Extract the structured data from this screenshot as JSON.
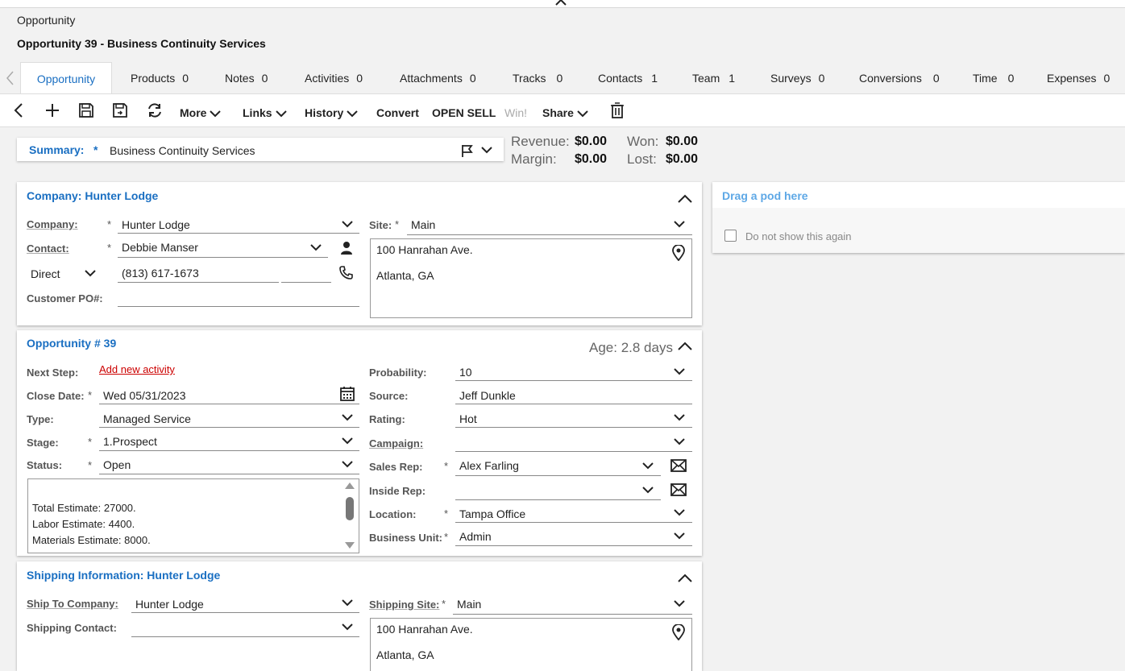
{
  "header": {
    "breadcrumb": "Opportunity",
    "title": "Opportunity 39 - Business Continuity Services"
  },
  "tabs": [
    {
      "label": "Opportunity",
      "count": ""
    },
    {
      "label": "Products",
      "count": "0"
    },
    {
      "label": "Notes",
      "count": "0"
    },
    {
      "label": "Activities",
      "count": "0"
    },
    {
      "label": "Attachments",
      "count": "0"
    },
    {
      "label": "Tracks",
      "count": "0"
    },
    {
      "label": "Contacts",
      "count": "1"
    },
    {
      "label": "Team",
      "count": "1"
    },
    {
      "label": "Surveys",
      "count": "0"
    },
    {
      "label": "Conversions",
      "count": "0"
    },
    {
      "label": "Time",
      "count": "0"
    },
    {
      "label": "Expenses",
      "count": "0"
    }
  ],
  "toolbar": {
    "more": "More",
    "links": "Links",
    "history": "History",
    "convert": "Convert",
    "open_sell": "OPEN SELL",
    "win": "Win!",
    "share": "Share"
  },
  "summary": {
    "label": "Summary:",
    "required": "*",
    "value": "Business Continuity Services"
  },
  "financials": {
    "revenue_label": "Revenue:",
    "revenue_value": "$0.00",
    "won_label": "Won:",
    "won_value": "$0.00",
    "margin_label": "Margin:",
    "margin_value": "$0.00",
    "lost_label": "Lost:",
    "lost_value": "$0.00"
  },
  "company_card": {
    "title": "Company: Hunter Lodge",
    "company_label": "Company:",
    "company_value": "Hunter Lodge",
    "contact_label": "Contact:",
    "contact_value": "Debbie Manser",
    "phone_type": "Direct",
    "phone_value": "(813) 617-1673",
    "po_label": "Customer PO#:",
    "site_label": "Site:",
    "site_value": "Main",
    "address_line1": "100 Hanrahan Ave.",
    "address_line2": "Atlanta, GA",
    "required": "*"
  },
  "opportunity_card": {
    "title": "Opportunity # 39",
    "age": "Age: 2.8 days",
    "next_step_label": "Next Step:",
    "next_step_link": "Add new activity",
    "close_date_label": "Close Date:",
    "close_date_value": "Wed 05/31/2023",
    "type_label": "Type:",
    "type_value": "Managed Service",
    "stage_label": "Stage:",
    "stage_value": "1.Prospect",
    "status_label": "Status:",
    "status_value": "Open",
    "notes_line1": "Total Estimate: 27000.",
    "notes_line2": "Labor Estimate: 4400.",
    "notes_line3": "Materials Estimate: 8000.",
    "probability_label": "Probability:",
    "probability_value": "10",
    "source_label": "Source:",
    "source_value": "Jeff Dunkle",
    "rating_label": "Rating:",
    "rating_value": "Hot",
    "campaign_label": "Campaign:",
    "campaign_value": "",
    "sales_rep_label": "Sales Rep:",
    "sales_rep_value": "Alex Farling",
    "inside_rep_label": "Inside Rep:",
    "inside_rep_value": "",
    "location_label": "Location:",
    "location_value": "Tampa Office",
    "business_unit_label": "Business Unit:",
    "business_unit_value": "Admin",
    "required": "*"
  },
  "shipping_card": {
    "title": "Shipping Information: Hunter Lodge",
    "ship_company_label": "Ship To Company:",
    "ship_company_value": "Hunter Lodge",
    "ship_contact_label": "Shipping Contact:",
    "ship_contact_value": "",
    "ship_site_label": "Shipping Site:",
    "ship_site_value": "Main",
    "address_line1": "100 Hanrahan Ave.",
    "address_line2": "Atlanta, GA",
    "required": "*"
  },
  "pod": {
    "title": "Drag a pod here",
    "checkbox_label": "Do not show this again"
  }
}
